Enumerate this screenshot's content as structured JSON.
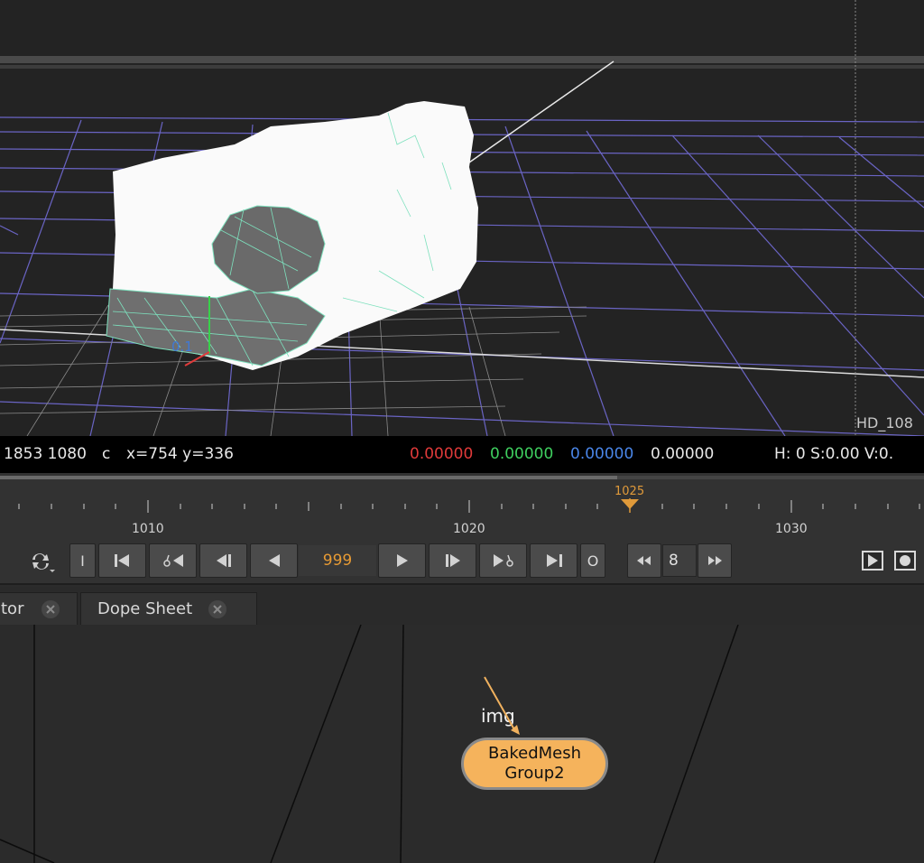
{
  "viewer": {
    "format_label": "HD_108",
    "axis_number": "0.1"
  },
  "info_bar": {
    "dims": "1853 1080",
    "channel_flag": "c",
    "coords": "x=754 y=336",
    "rgba": {
      "r": "0.00000",
      "g": "0.00000",
      "b": "0.00000",
      "a": "0.00000"
    },
    "r_color": "#e03a3a",
    "g_color": "#3fcf5f",
    "b_color": "#4a86e8",
    "hsv": "H:  0 S:0.00 V:0."
  },
  "timeline": {
    "tick_labels": [
      "1010",
      "1020",
      "1030"
    ],
    "current_frame_marker": "1025",
    "marker_color": "#e09a3a"
  },
  "transport": {
    "in_label": "I",
    "out_label": "O",
    "frame_value": "999",
    "step_value": "8"
  },
  "tabs": [
    {
      "label": "tor"
    },
    {
      "label": "Dope Sheet"
    }
  ],
  "node_graph": {
    "input_label": "img",
    "node_line1": "BakedMesh",
    "node_line2": "Group2",
    "node_color": "#f5b35c"
  }
}
